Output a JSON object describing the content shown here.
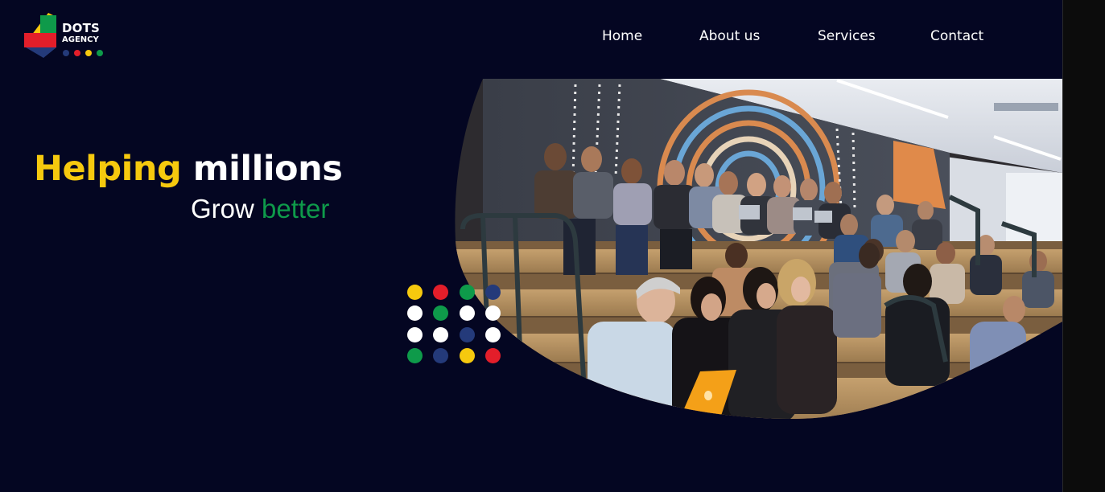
{
  "logo": {
    "word": "DOTS",
    "sub": "AGENCY",
    "dot_colors": [
      "#243a7a",
      "#e31e2a",
      "#f6c90e",
      "#0e9a4a"
    ]
  },
  "nav": {
    "items": [
      {
        "label": "Home"
      },
      {
        "label": "About us"
      },
      {
        "label": "Services"
      },
      {
        "label": "Contact"
      }
    ]
  },
  "hero": {
    "line1_highlight": "Helping",
    "line1_rest": "millions",
    "line2_start": "Grow",
    "line2_highlight": "better",
    "photo_icon": "audience-photo"
  },
  "colors": {
    "background": "#040622",
    "yellow": "#f6c90e",
    "red": "#e31e2a",
    "green": "#0e9a4a",
    "blue": "#243a7a",
    "white": "#ffffff"
  },
  "dot_grid": [
    [
      "#f6c90e",
      "#e31e2a",
      "#0e9a4a",
      "#243a7a"
    ],
    [
      "#ffffff",
      "#0e9a4a",
      "#ffffff",
      "#ffffff"
    ],
    [
      "#ffffff",
      "#ffffff",
      "#243a7a",
      "#ffffff"
    ],
    [
      "#0e9a4a",
      "#243a7a",
      "#f6c90e",
      "#e31e2a"
    ]
  ]
}
